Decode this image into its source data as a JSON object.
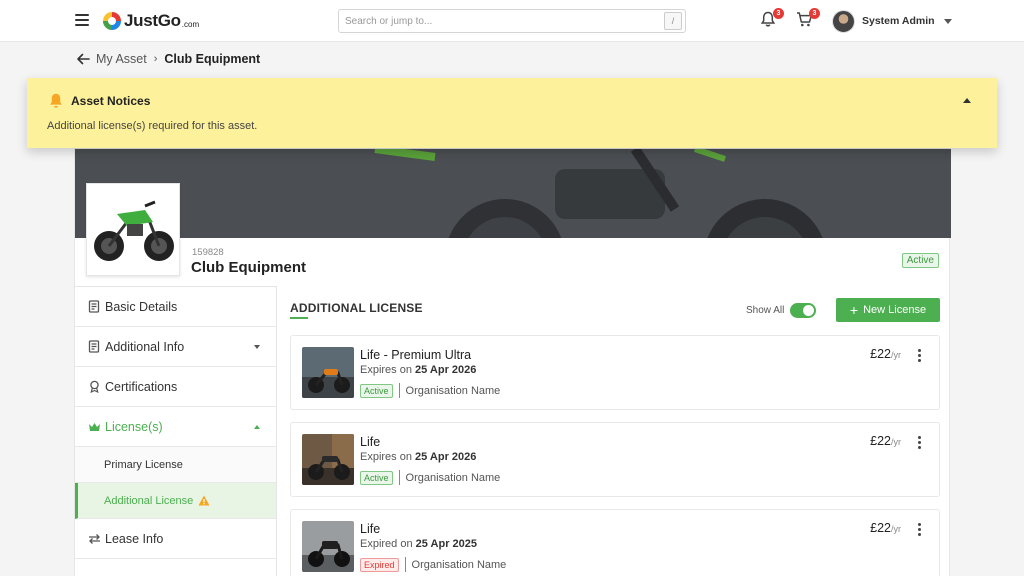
{
  "header": {
    "logo_text": "JustGo",
    "logo_sub": ".com",
    "search_placeholder": "Search or jump to...",
    "search_shortcut": "/",
    "notifications_count": "3",
    "cart_count": "3",
    "user_name": "System Admin"
  },
  "breadcrumb": {
    "parent": "My Asset",
    "current": "Club Equipment"
  },
  "notice": {
    "title": "Asset Notices",
    "message": "Additional license(s) required for this asset.",
    "color": "#fdf29b"
  },
  "asset": {
    "id": "159828",
    "name": "Club Equipment",
    "status": "Active"
  },
  "sidebar": {
    "items": [
      {
        "label": "Basic Details"
      },
      {
        "label": "Additional Info"
      },
      {
        "label": "Certifications"
      },
      {
        "label": "License(s)"
      },
      {
        "label": "Primary License"
      },
      {
        "label": "Additional License"
      },
      {
        "label": "Lease Info"
      }
    ]
  },
  "panel": {
    "title": "ADDITIONAL LICENSE",
    "show_all_label": "Show All",
    "new_button_label": "New License",
    "accent_color": "#4caf50"
  },
  "licenses": [
    {
      "name": "Life - Premium Ultra",
      "exp_prefix": "Expires on",
      "exp_date": "25 Apr 2026",
      "status": "Active",
      "org": "Organisation Name",
      "price": "£22",
      "per": "/yr"
    },
    {
      "name": "Life",
      "exp_prefix": "Expires on",
      "exp_date": "25 Apr 2026",
      "status": "Active",
      "org": "Organisation Name",
      "price": "£22",
      "per": "/yr"
    },
    {
      "name": "Life",
      "exp_prefix": "Expired on",
      "exp_date": "25 Apr 2025",
      "status": "Expired",
      "org": "Organisation Name",
      "price": "£22",
      "per": "/yr"
    }
  ]
}
